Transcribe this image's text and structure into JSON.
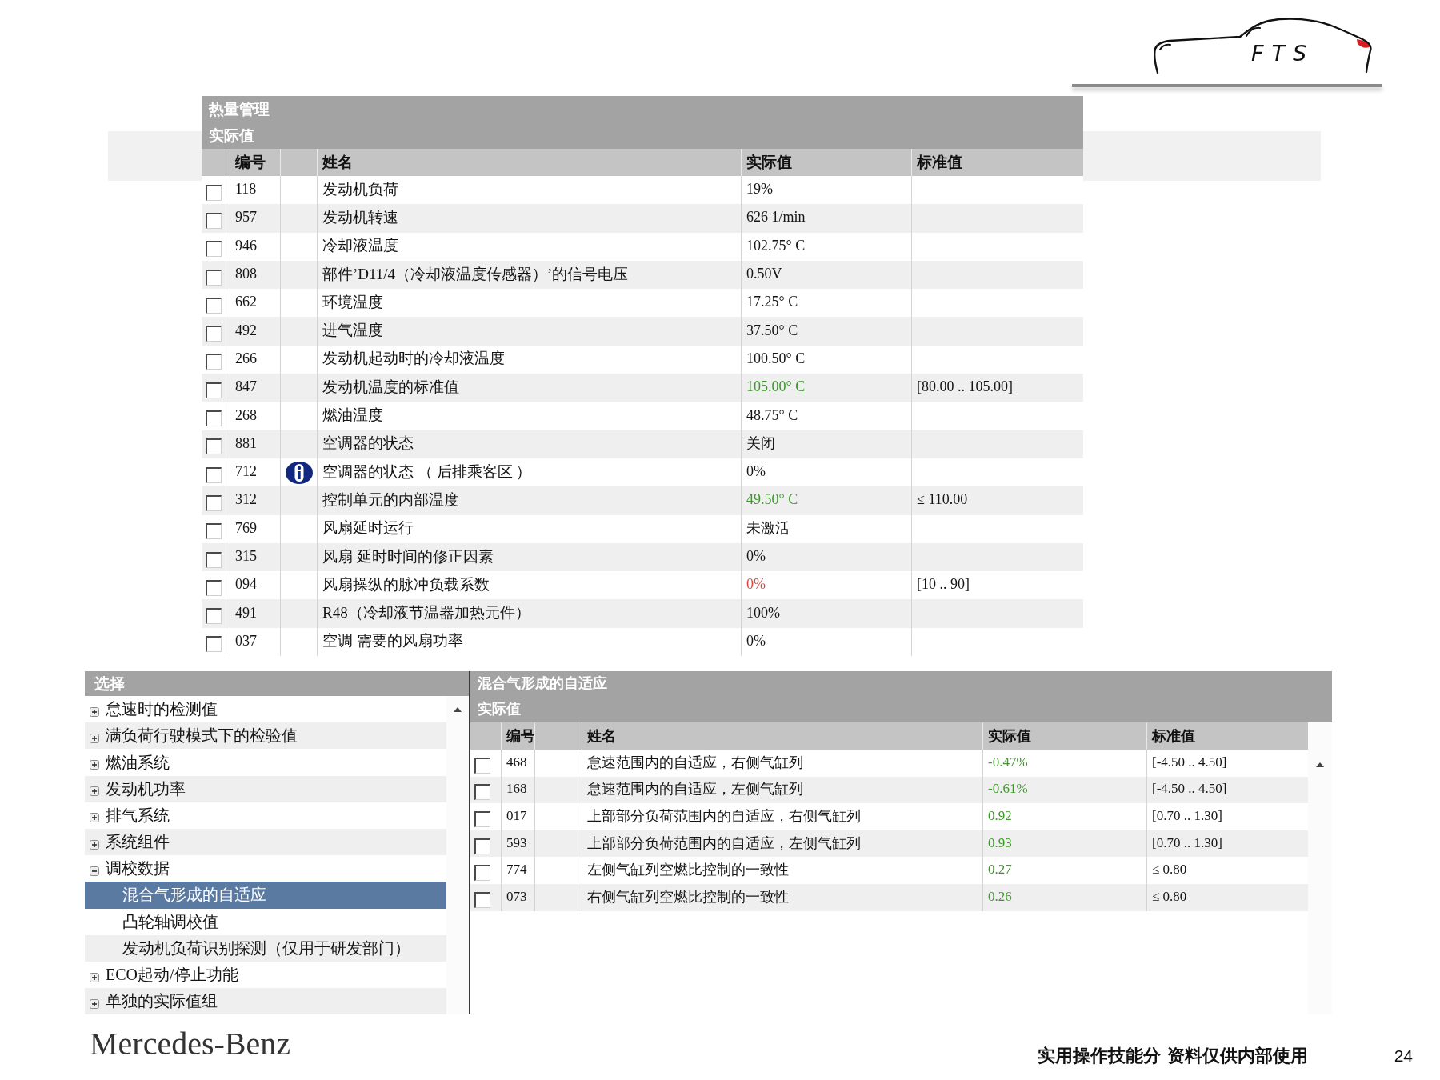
{
  "logo": {
    "text": "FTS"
  },
  "top_table": {
    "title": "热量管理",
    "subtitle": "实际值",
    "columns": [
      "编号",
      "姓名",
      "实际值",
      "标准值"
    ],
    "rows": [
      {
        "checked": false,
        "id": "118",
        "info": false,
        "name": "发动机负荷",
        "value": "19%",
        "kind": "plain"
      },
      {
        "checked": false,
        "id": "957",
        "info": false,
        "name": "发动机转速",
        "value": "626 1/min",
        "kind": "plain"
      },
      {
        "checked": false,
        "id": "946",
        "info": false,
        "name": "冷却液温度",
        "value": "102.75° C",
        "kind": "plain"
      },
      {
        "checked": false,
        "id": "808",
        "info": false,
        "name": "部件’D11/4（冷却液温度传感器）’的信号电压",
        "value": "0.50V",
        "kind": "plain"
      },
      {
        "checked": false,
        "id": "662",
        "info": false,
        "name": "环境温度",
        "value": "17.25° C",
        "kind": "plain"
      },
      {
        "checked": false,
        "id": "492",
        "info": false,
        "name": "进气温度",
        "value": "37.50° C",
        "kind": "plain"
      },
      {
        "checked": false,
        "id": "266",
        "info": false,
        "name": "发动机起动时的冷却液温度",
        "value": "100.50° C",
        "kind": "plain"
      },
      {
        "checked": false,
        "id": "847",
        "info": false,
        "name": "发动机温度的标准值",
        "value": "105.00° C",
        "kind": "ok",
        "standard": "[80.00 .. 105.00]"
      },
      {
        "checked": false,
        "id": "268",
        "info": false,
        "name": "燃油温度",
        "value": "48.75° C",
        "kind": "plain"
      },
      {
        "checked": false,
        "id": "881",
        "info": false,
        "name": "空调器的状态",
        "value": "关闭",
        "kind": "plain"
      },
      {
        "checked": false,
        "id": "712",
        "info": true,
        "name": "空调器的状态 （ 后排乘客区 ）",
        "value": "0%",
        "kind": "plain"
      },
      {
        "checked": false,
        "id": "312",
        "info": false,
        "name": "控制单元的内部温度",
        "value": "49.50° C",
        "kind": "ok",
        "standard": "≤ 110.00"
      },
      {
        "checked": false,
        "id": "769",
        "info": false,
        "name": "风扇延时运行",
        "value": "未激活",
        "kind": "plain"
      },
      {
        "checked": false,
        "id": "315",
        "info": false,
        "name": "风扇 延时时间的修正因素",
        "value": "0%",
        "kind": "plain"
      },
      {
        "checked": false,
        "id": "094",
        "info": false,
        "name": "风扇操纵的脉冲负载系数",
        "value": "0%",
        "kind": "fault",
        "standard": "[10 .. 90]"
      },
      {
        "checked": false,
        "id": "491",
        "info": false,
        "name": "R48（冷却液节温器加热元件）",
        "value": "100%",
        "kind": "plain"
      },
      {
        "checked": false,
        "id": "037",
        "info": false,
        "name": "空调 需要的风扇功率",
        "value": "0%",
        "kind": "plain"
      }
    ]
  },
  "tree": {
    "title": "选择",
    "items": [
      {
        "label": "怠速时的检测值",
        "expanded": false,
        "selected": false
      },
      {
        "label": "满负荷行驶模式下的检验值",
        "expanded": false,
        "selected": false
      },
      {
        "label": "燃油系统",
        "expanded": false,
        "selected": false
      },
      {
        "label": "发动机功率",
        "expanded": false,
        "selected": false
      },
      {
        "label": "排气系统",
        "expanded": false,
        "selected": false
      },
      {
        "label": "系统组件",
        "expanded": false,
        "selected": false
      },
      {
        "label": "调校数据",
        "expanded": true,
        "selected": false,
        "children": [
          {
            "label": "混合气形成的自适应",
            "selected": true
          },
          {
            "label": "凸轮轴调校值",
            "selected": false
          },
          {
            "label": "发动机负荷识别探测（仅用于研发部门）",
            "selected": false
          }
        ]
      },
      {
        "label": "ECO起动/停止功能",
        "expanded": false,
        "selected": false
      },
      {
        "label": "单独的实际值组",
        "expanded": false,
        "selected": false
      }
    ]
  },
  "bottom_table": {
    "title": "混合气形成的自适应",
    "subtitle": "实际值",
    "columns": [
      "编号",
      "姓名",
      "实际值",
      "标准值"
    ],
    "rows": [
      {
        "checked": false,
        "id": "468",
        "info": false,
        "name": "怠速范围内的自适应，右侧气缸列",
        "value": "-0.47%",
        "kind": "ok",
        "standard": "[-4.50 .. 4.50]"
      },
      {
        "checked": false,
        "id": "168",
        "info": false,
        "name": "怠速范围内的自适应，左侧气缸列",
        "value": "-0.61%",
        "kind": "ok",
        "standard": "[-4.50 .. 4.50]"
      },
      {
        "checked": false,
        "id": "017",
        "info": false,
        "name": "上部部分负荷范围内的自适应，右侧气缸列",
        "value": "0.92",
        "kind": "ok",
        "standard": "[0.70 .. 1.30]"
      },
      {
        "checked": false,
        "id": "593",
        "info": false,
        "name": "上部部分负荷范围内的自适应，左侧气缸列",
        "value": "0.93",
        "kind": "ok",
        "standard": "[0.70 .. 1.30]"
      },
      {
        "checked": false,
        "id": "774",
        "info": false,
        "name": "左侧气缸列空燃比控制的一致性",
        "value": "0.27",
        "kind": "ok",
        "standard": "≤ 0.80"
      },
      {
        "checked": false,
        "id": "073",
        "info": false,
        "name": "右侧气缸列空燃比控制的一致性",
        "value": "0.26",
        "kind": "ok",
        "standard": "≤ 0.80"
      }
    ]
  },
  "footer": {
    "brand": "Mercedes-Benz",
    "note": "实用操作技能分 资料仅供内部使用",
    "page": "24"
  }
}
